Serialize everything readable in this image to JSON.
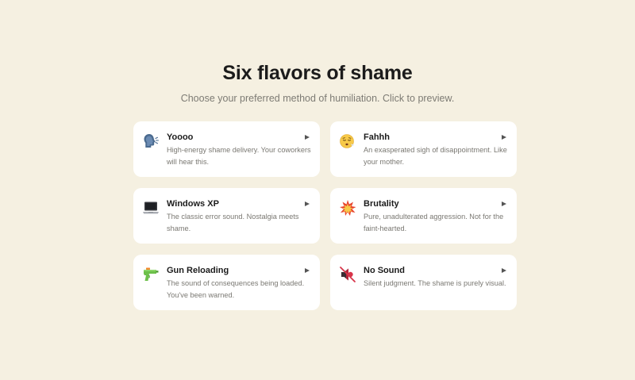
{
  "header": {
    "title": "Six flavors of shame",
    "subtitle": "Choose your preferred method of humiliation. Click to preview."
  },
  "sounds": [
    {
      "name": "Yoooo",
      "description": "High-energy shame delivery. Your coworkers will hear this.",
      "icon": "speaking-head-icon"
    },
    {
      "name": "Fahhh",
      "description": "An exasperated sigh of disappointment. Like your mother.",
      "icon": "sighing-face-icon"
    },
    {
      "name": "Windows XP",
      "description": "The classic error sound. Nostalgia meets shame.",
      "icon": "laptop-icon"
    },
    {
      "name": "Brutality",
      "description": "Pure, unadulterated aggression. Not for the faint-hearted.",
      "icon": "collision-icon"
    },
    {
      "name": "Gun Reloading",
      "description": "The sound of consequences being loaded. You've been warned.",
      "icon": "water-pistol-icon"
    },
    {
      "name": "No Sound",
      "description": "Silent judgment. The shame is purely visual.",
      "icon": "muted-speaker-icon"
    }
  ]
}
